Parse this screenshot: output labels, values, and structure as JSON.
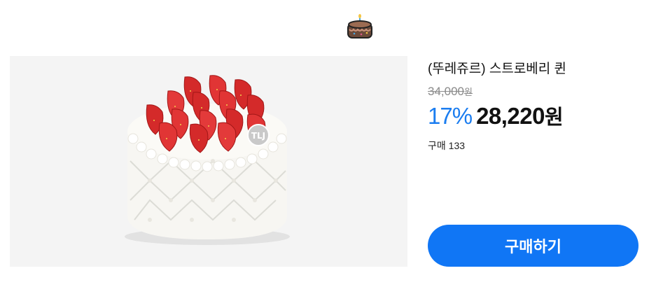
{
  "header": {
    "icon": "birthday-cake-icon"
  },
  "product": {
    "image": "strawberry-cake-photo",
    "logo_text": "TLJ",
    "name": "(뚜레쥬르) 스트로베리 퀸",
    "original_price": "34,000",
    "original_price_unit": "원",
    "discount": "17%",
    "sale_price": "28,220",
    "sale_price_unit": "원",
    "purchase_label": "구매",
    "purchase_count": "133"
  },
  "actions": {
    "buy_label": "구매하기"
  },
  "colors": {
    "accent": "#1076f5",
    "discount": "#1b7df0",
    "image_bg": "#f4f4f4"
  }
}
